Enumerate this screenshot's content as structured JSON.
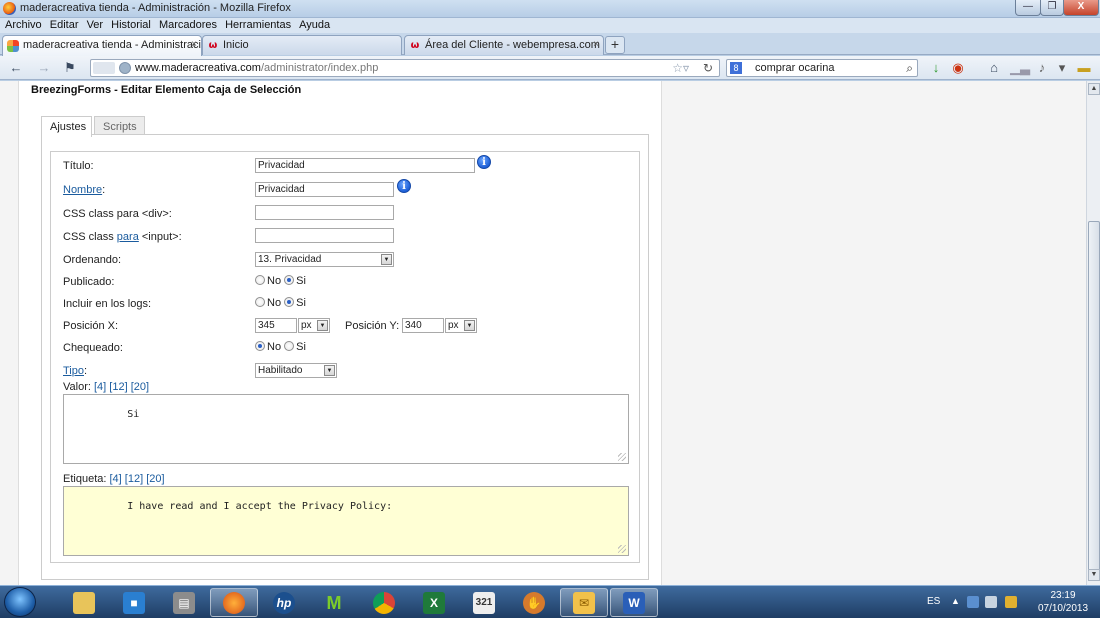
{
  "window": {
    "title": "maderacreativa tienda - Administración - Mozilla Firefox",
    "min_glyph": "—",
    "max_glyph": "❐",
    "close_glyph": "X"
  },
  "menu": [
    "Archivo",
    "Editar",
    "Ver",
    "Historial",
    "Marcadores",
    "Herramientas",
    "Ayuda"
  ],
  "tabs": [
    {
      "label": "maderacreativa tienda - Administraci...",
      "icon": "joomla-icon",
      "close": "×",
      "active": true
    },
    {
      "label": "Inicio",
      "icon": "w-logo-icon",
      "close": "",
      "active": false
    },
    {
      "label": "Área del Cliente - webempresa.com",
      "icon": "w-logo-icon",
      "close": "×",
      "active": false
    }
  ],
  "new_tab_label": "+",
  "nav": {
    "url_host": "www.maderacreativa.com",
    "url_path": "/administrator/index.php",
    "search_value": "comprar ocarina"
  },
  "page": {
    "title": "BreezingForms - Editar Elemento Caja de Selección",
    "tabs": [
      "Ajustes",
      "Scripts"
    ],
    "fields": {
      "titulo_label": "Título:",
      "titulo_value": "Privacidad",
      "nombre_label": "Nombre",
      "nombre_colon": ":",
      "nombre_value": "Privacidad",
      "css_div_label": "CSS class para <div>:",
      "css_div_value": "",
      "css_input_label_pre": "CSS class ",
      "css_input_label_link": "para",
      "css_input_label_post": " <input>:",
      "css_input_value": "",
      "ordenando_label": "Ordenando:",
      "ordenando_value": "13. Privacidad",
      "publicado_label": "Publicado:",
      "publicado_value": "Si",
      "logs_label": "Incluir en los logs:",
      "logs_value": "Si",
      "posx_label": "Posición X:",
      "posx_value": "345",
      "posx_unit": "px",
      "posy_label": "Posición Y:",
      "posy_value": "340",
      "posy_unit": "px",
      "chequeado_label": "Chequeado:",
      "chequeado_value": "No",
      "tipo_label": "Tipo",
      "tipo_colon": ":",
      "tipo_value": "Habilitado",
      "radio_no": "No",
      "radio_si": "Si",
      "valor_label": "Valor:",
      "valor_sizes": [
        "[4]",
        "[12]",
        "[20]"
      ],
      "valor_text": "Si",
      "etiqueta_label": "Etiqueta:",
      "etiqueta_sizes": [
        "[4]",
        "[12]",
        "[20]"
      ],
      "etiqueta_text": "I have read and I accept the Privacy Policy:"
    }
  },
  "taskbar": {
    "lang": "ES",
    "time": "23:19",
    "date": "07/10/2013",
    "apps": [
      "explorer",
      "media-center",
      "documents",
      "firefox",
      "hp",
      "movistar",
      "chrome",
      "excel",
      "calendar",
      "game",
      "outlook",
      "word"
    ]
  }
}
